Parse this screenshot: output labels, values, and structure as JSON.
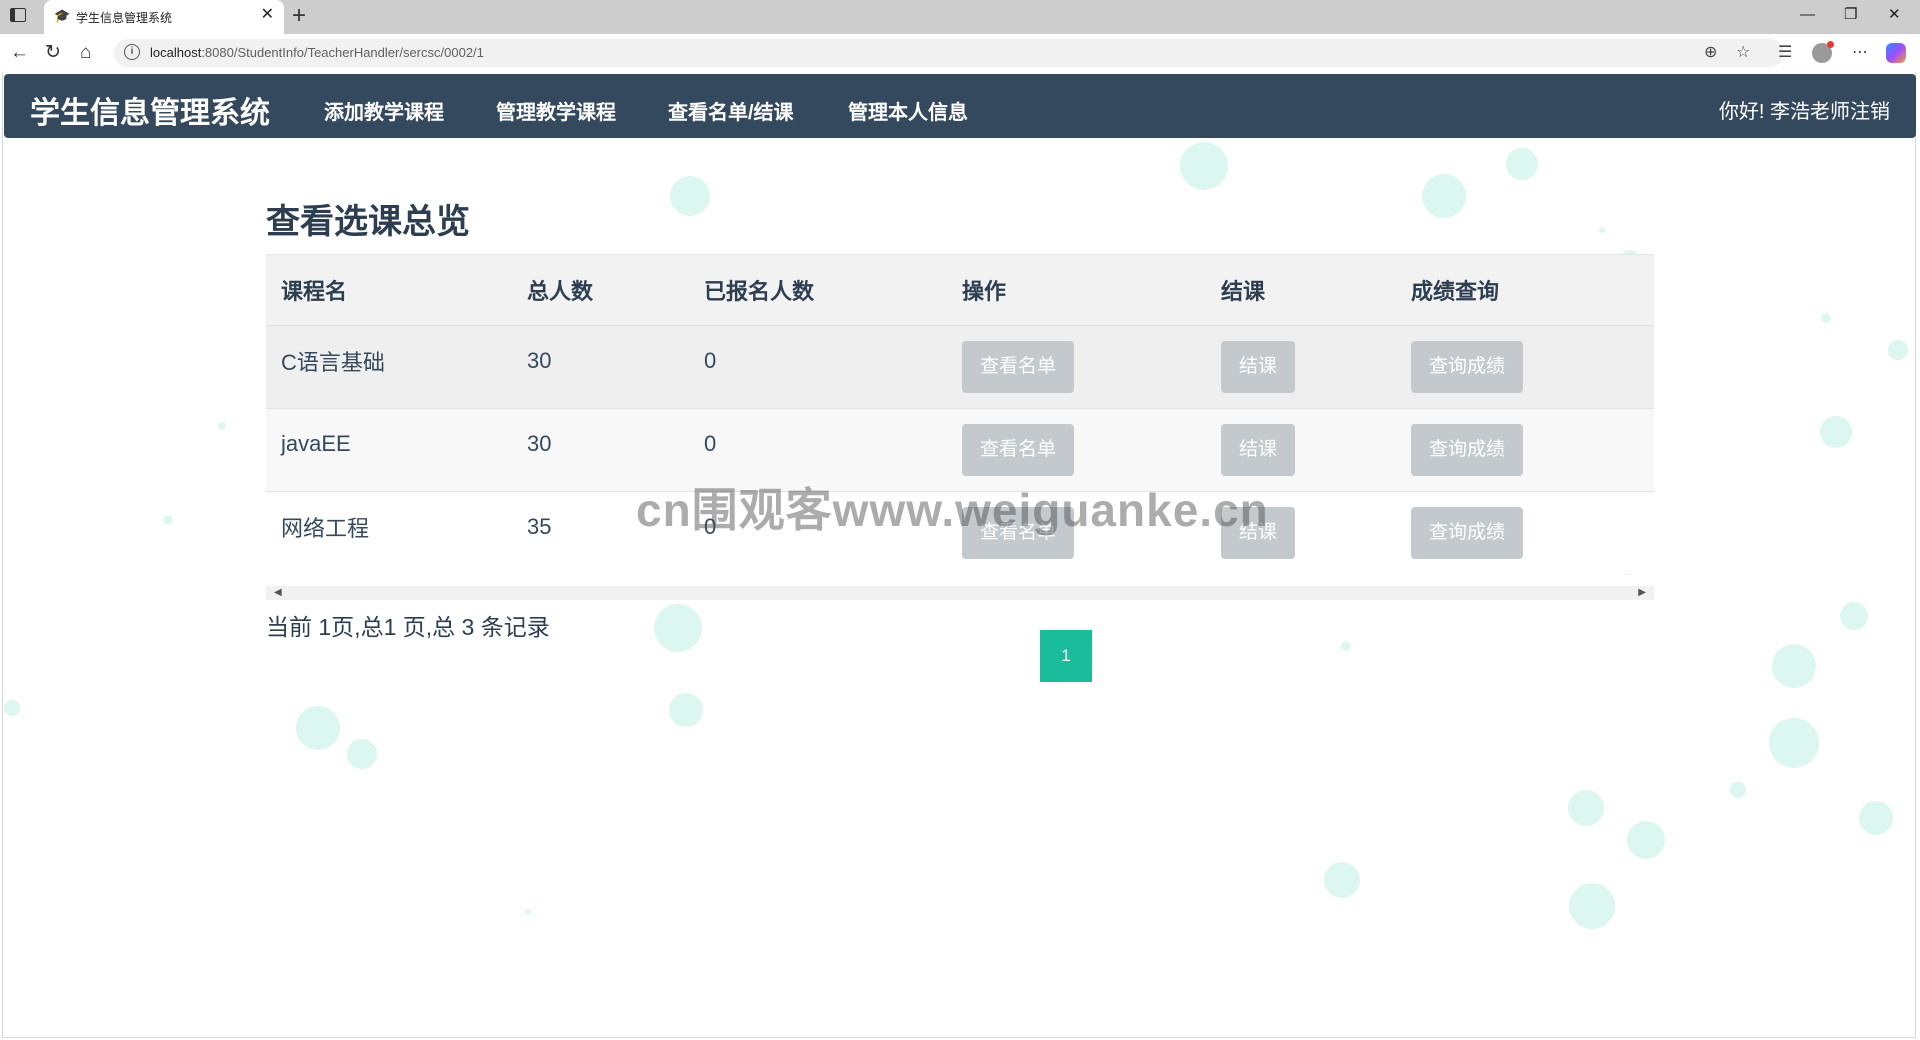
{
  "browser": {
    "tab_title": "学生信息管理系统",
    "url_host": "localhost",
    "url_rest": ":8080/StudentInfo/TeacherHandler/sercsc/0002/1"
  },
  "nav": {
    "brand": "学生信息管理系统",
    "links": [
      "添加教学课程",
      "管理教学课程",
      "查看名单/结课",
      "管理本人信息"
    ],
    "greeting": "你好!",
    "user": "李浩",
    "logout": "老师注销"
  },
  "page": {
    "title": "查看选课总览",
    "columns": [
      "课程名",
      "总人数",
      "已报名人数",
      "操作",
      "结课",
      "成绩查询"
    ],
    "rows": [
      {
        "name": "C语言基础",
        "total": "30",
        "enrolled": "0",
        "view": "查看名单",
        "finish": "结课",
        "grades": "查询成绩"
      },
      {
        "name": "javaEE",
        "total": "30",
        "enrolled": "0",
        "view": "查看名单",
        "finish": "结课",
        "grades": "查询成绩"
      },
      {
        "name": "网络工程",
        "total": "35",
        "enrolled": "0",
        "view": "查看名单",
        "finish": "结课",
        "grades": "查询成绩"
      }
    ],
    "pagination_info": "当前 1页,总1 页,总 3 条记录",
    "current_page": "1"
  },
  "watermark": "cn围观客www.weiguanke.cn",
  "colors": {
    "navbar": "#34495e",
    "accent": "#1abc9c",
    "button_disabled": "#c3c9cd"
  }
}
